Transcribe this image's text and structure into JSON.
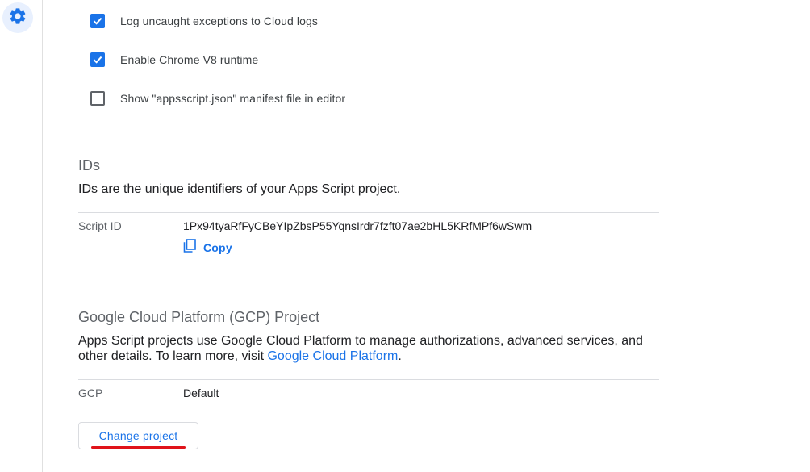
{
  "sidebar": {
    "settings_icon": "gear-icon"
  },
  "checkboxes": [
    {
      "label": "Log uncaught exceptions to Cloud logs",
      "checked": true
    },
    {
      "label": "Enable Chrome V8 runtime",
      "checked": true
    },
    {
      "label": "Show \"appsscript.json\" manifest file in editor",
      "checked": false
    }
  ],
  "ids_section": {
    "title": "IDs",
    "description": "IDs are the unique identifiers of your Apps Script project.",
    "script_id_label": "Script ID",
    "script_id_value": "1Px94tyaRfFyCBeYIpZbsP55YqnsIrdr7fzft07ae2bHL5KRfMPf6wSwm",
    "copy_label": "Copy",
    "copy_icon": "copy-icon"
  },
  "gcp_section": {
    "title": "Google Cloud Platform (GCP) Project",
    "description_prefix": "Apps Script projects use Google Cloud Platform to manage authorizations, advanced services, and other details. To learn more, visit ",
    "description_link": "Google Cloud Platform",
    "description_suffix": ".",
    "gcp_label": "GCP",
    "gcp_value": "Default",
    "change_button_label": "Change project"
  },
  "colors": {
    "accent": "#1a73e8",
    "annotation_underline": "#e0131a"
  }
}
